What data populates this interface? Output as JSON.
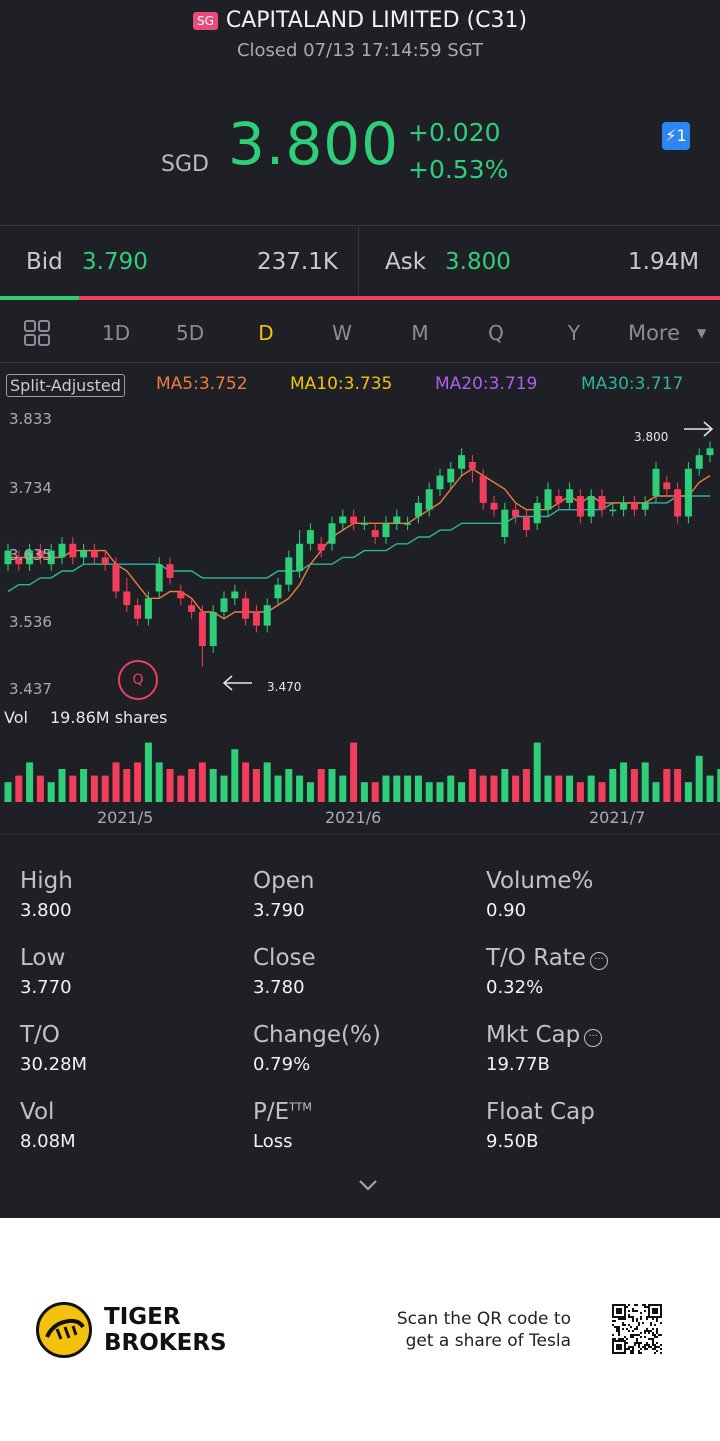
{
  "header": {
    "market_badge": "SG",
    "title": "CAPITALAND LIMITED (C31)",
    "status": "Closed 07/13 17:14:59 SGT",
    "currency": "SGD",
    "price": "3.800",
    "change": "+0.020",
    "change_pct": "+0.53%",
    "flash_icon_text": "⚡1"
  },
  "quote": {
    "bid_label": "Bid",
    "bid_price": "3.790",
    "bid_size": "237.1K",
    "ask_label": "Ask",
    "ask_price": "3.800",
    "ask_size": "1.94M",
    "bid_ratio": 0.11
  },
  "tabs": [
    {
      "label": "1D"
    },
    {
      "label": "5D"
    },
    {
      "label": "D",
      "active": true
    },
    {
      "label": "W"
    },
    {
      "label": "M"
    },
    {
      "label": "Q"
    },
    {
      "label": "Y"
    },
    {
      "label": "More"
    }
  ],
  "chart": {
    "split_adjusted": "Split-Adjusted",
    "ma5": "MA5:3.752",
    "ma10": "MA10:3.735",
    "ma20": "MA20:3.719",
    "ma30": "MA30:3.717",
    "y_ticks": [
      "3.833",
      "3.734",
      "3.635",
      "3.536",
      "3.437"
    ],
    "high_label": "3.800",
    "low_label": "3.470",
    "marker": "Q",
    "vol_label": "Vol",
    "vol_value": "19.86M shares",
    "x_ticks": [
      "2021/5",
      "2021/6",
      "2021/7"
    ],
    "colors": {
      "up": "#2fcf7a",
      "down": "#f23e5c",
      "ma5": "#f07a3a",
      "ma10": "#f4c20d",
      "ma20": "#b05ef0",
      "ma30": "#2fb3a0"
    }
  },
  "chart_data": {
    "type": "candlestick",
    "title": "",
    "ylim": [
      3.437,
      3.833
    ],
    "candles": [
      {
        "o": 3.62,
        "c": 3.64,
        "h": 3.65,
        "l": 3.61
      },
      {
        "o": 3.63,
        "c": 3.62,
        "h": 3.64,
        "l": 3.61
      },
      {
        "o": 3.62,
        "c": 3.64,
        "h": 3.65,
        "l": 3.61
      },
      {
        "o": 3.64,
        "c": 3.63,
        "h": 3.65,
        "l": 3.62
      },
      {
        "o": 3.62,
        "c": 3.64,
        "h": 3.65,
        "l": 3.61
      },
      {
        "o": 3.63,
        "c": 3.65,
        "h": 3.66,
        "l": 3.62
      },
      {
        "o": 3.65,
        "c": 3.63,
        "h": 3.66,
        "l": 3.62
      },
      {
        "o": 3.63,
        "c": 3.64,
        "h": 3.65,
        "l": 3.62
      },
      {
        "o": 3.64,
        "c": 3.63,
        "h": 3.65,
        "l": 3.62
      },
      {
        "o": 3.63,
        "c": 3.62,
        "h": 3.64,
        "l": 3.61
      },
      {
        "o": 3.62,
        "c": 3.58,
        "h": 3.63,
        "l": 3.57
      },
      {
        "o": 3.58,
        "c": 3.56,
        "h": 3.6,
        "l": 3.55
      },
      {
        "o": 3.56,
        "c": 3.54,
        "h": 3.57,
        "l": 3.53
      },
      {
        "o": 3.54,
        "c": 3.57,
        "h": 3.58,
        "l": 3.53
      },
      {
        "o": 3.58,
        "c": 3.62,
        "h": 3.63,
        "l": 3.57
      },
      {
        "o": 3.62,
        "c": 3.6,
        "h": 3.63,
        "l": 3.59
      },
      {
        "o": 3.58,
        "c": 3.57,
        "h": 3.59,
        "l": 3.56
      },
      {
        "o": 3.56,
        "c": 3.55,
        "h": 3.57,
        "l": 3.54
      },
      {
        "o": 3.55,
        "c": 3.5,
        "h": 3.56,
        "l": 3.47
      },
      {
        "o": 3.5,
        "c": 3.55,
        "h": 3.56,
        "l": 3.49
      },
      {
        "o": 3.55,
        "c": 3.57,
        "h": 3.58,
        "l": 3.54
      },
      {
        "o": 3.57,
        "c": 3.58,
        "h": 3.59,
        "l": 3.56
      },
      {
        "o": 3.57,
        "c": 3.54,
        "h": 3.58,
        "l": 3.53
      },
      {
        "o": 3.55,
        "c": 3.53,
        "h": 3.56,
        "l": 3.52
      },
      {
        "o": 3.53,
        "c": 3.56,
        "h": 3.57,
        "l": 3.52
      },
      {
        "o": 3.57,
        "c": 3.59,
        "h": 3.6,
        "l": 3.56
      },
      {
        "o": 3.59,
        "c": 3.63,
        "h": 3.64,
        "l": 3.58
      },
      {
        "o": 3.61,
        "c": 3.65,
        "h": 3.67,
        "l": 3.6
      },
      {
        "o": 3.65,
        "c": 3.67,
        "h": 3.68,
        "l": 3.64
      },
      {
        "o": 3.65,
        "c": 3.64,
        "h": 3.66,
        "l": 3.63
      },
      {
        "o": 3.65,
        "c": 3.68,
        "h": 3.69,
        "l": 3.64
      },
      {
        "o": 3.68,
        "c": 3.69,
        "h": 3.7,
        "l": 3.67
      },
      {
        "o": 3.69,
        "c": 3.68,
        "h": 3.7,
        "l": 3.67
      },
      {
        "o": 3.68,
        "c": 3.68,
        "h": 3.69,
        "l": 3.67
      },
      {
        "o": 3.67,
        "c": 3.66,
        "h": 3.68,
        "l": 3.65
      },
      {
        "o": 3.66,
        "c": 3.68,
        "h": 3.69,
        "l": 3.65
      },
      {
        "o": 3.68,
        "c": 3.69,
        "h": 3.7,
        "l": 3.67
      },
      {
        "o": 3.68,
        "c": 3.68,
        "h": 3.69,
        "l": 3.67
      },
      {
        "o": 3.69,
        "c": 3.71,
        "h": 3.72,
        "l": 3.68
      },
      {
        "o": 3.7,
        "c": 3.73,
        "h": 3.74,
        "l": 3.69
      },
      {
        "o": 3.73,
        "c": 3.75,
        "h": 3.76,
        "l": 3.72
      },
      {
        "o": 3.74,
        "c": 3.76,
        "h": 3.77,
        "l": 3.73
      },
      {
        "o": 3.76,
        "c": 3.78,
        "h": 3.79,
        "l": 3.75
      },
      {
        "o": 3.77,
        "c": 3.76,
        "h": 3.78,
        "l": 3.74
      },
      {
        "o": 3.75,
        "c": 3.71,
        "h": 3.76,
        "l": 3.7
      },
      {
        "o": 3.71,
        "c": 3.7,
        "h": 3.72,
        "l": 3.69
      },
      {
        "o": 3.66,
        "c": 3.7,
        "h": 3.71,
        "l": 3.65
      },
      {
        "o": 3.7,
        "c": 3.69,
        "h": 3.71,
        "l": 3.68
      },
      {
        "o": 3.69,
        "c": 3.67,
        "h": 3.7,
        "l": 3.66
      },
      {
        "o": 3.68,
        "c": 3.71,
        "h": 3.72,
        "l": 3.67
      },
      {
        "o": 3.7,
        "c": 3.73,
        "h": 3.74,
        "l": 3.69
      },
      {
        "o": 3.72,
        "c": 3.71,
        "h": 3.73,
        "l": 3.7
      },
      {
        "o": 3.71,
        "c": 3.73,
        "h": 3.74,
        "l": 3.7
      },
      {
        "o": 3.72,
        "c": 3.69,
        "h": 3.73,
        "l": 3.68
      },
      {
        "o": 3.69,
        "c": 3.72,
        "h": 3.73,
        "l": 3.68
      },
      {
        "o": 3.72,
        "c": 3.7,
        "h": 3.73,
        "l": 3.69
      },
      {
        "o": 3.7,
        "c": 3.7,
        "h": 3.71,
        "l": 3.69
      },
      {
        "o": 3.7,
        "c": 3.71,
        "h": 3.72,
        "l": 3.69
      },
      {
        "o": 3.71,
        "c": 3.7,
        "h": 3.72,
        "l": 3.69
      },
      {
        "o": 3.7,
        "c": 3.71,
        "h": 3.72,
        "l": 3.69
      },
      {
        "o": 3.72,
        "c": 3.76,
        "h": 3.77,
        "l": 3.71
      },
      {
        "o": 3.74,
        "c": 3.73,
        "h": 3.75,
        "l": 3.72
      },
      {
        "o": 3.73,
        "c": 3.69,
        "h": 3.74,
        "l": 3.68
      },
      {
        "o": 3.69,
        "c": 3.76,
        "h": 3.77,
        "l": 3.68
      },
      {
        "o": 3.76,
        "c": 3.78,
        "h": 3.79,
        "l": 3.75
      },
      {
        "o": 3.78,
        "c": 3.79,
        "h": 3.8,
        "l": 3.77
      }
    ],
    "volume_shares_rel": [
      0.3,
      0.4,
      0.6,
      0.4,
      0.3,
      0.5,
      0.4,
      0.5,
      0.4,
      0.4,
      0.6,
      0.5,
      0.6,
      0.9,
      0.6,
      0.5,
      0.4,
      0.5,
      0.6,
      0.5,
      0.4,
      0.8,
      0.6,
      0.5,
      0.6,
      0.4,
      0.5,
      0.4,
      0.3,
      0.5,
      0.5,
      0.4,
      0.9,
      0.3,
      0.3,
      0.4,
      0.4,
      0.4,
      0.4,
      0.3,
      0.3,
      0.4,
      0.3,
      0.5,
      0.4,
      0.4,
      0.5,
      0.4,
      0.5,
      0.9,
      0.4,
      0.4,
      0.4,
      0.3,
      0.4,
      0.3,
      0.5,
      0.6,
      0.5,
      0.6,
      0.3,
      0.5,
      0.5,
      0.3,
      0.7,
      0.4,
      0.5
    ],
    "ma5": [
      3.63,
      3.63,
      3.63,
      3.63,
      3.63,
      3.63,
      3.64,
      3.64,
      3.64,
      3.64,
      3.62,
      3.61,
      3.59,
      3.57,
      3.57,
      3.58,
      3.58,
      3.57,
      3.55,
      3.55,
      3.54,
      3.55,
      3.55,
      3.55,
      3.55,
      3.56,
      3.57,
      3.59,
      3.62,
      3.64,
      3.66,
      3.67,
      3.68,
      3.68,
      3.68,
      3.68,
      3.68,
      3.68,
      3.69,
      3.7,
      3.71,
      3.73,
      3.75,
      3.76,
      3.75,
      3.74,
      3.73,
      3.71,
      3.7,
      3.7,
      3.7,
      3.71,
      3.72,
      3.71,
      3.72,
      3.71,
      3.71,
      3.71,
      3.71,
      3.71,
      3.72,
      3.72,
      3.72,
      3.72,
      3.74,
      3.75
    ],
    "ma30": [
      3.58,
      3.59,
      3.59,
      3.6,
      3.6,
      3.61,
      3.61,
      3.62,
      3.62,
      3.62,
      3.62,
      3.62,
      3.62,
      3.62,
      3.62,
      3.61,
      3.61,
      3.61,
      3.6,
      3.6,
      3.6,
      3.6,
      3.6,
      3.6,
      3.6,
      3.61,
      3.61,
      3.61,
      3.62,
      3.62,
      3.62,
      3.63,
      3.63,
      3.64,
      3.64,
      3.64,
      3.65,
      3.65,
      3.66,
      3.66,
      3.67,
      3.67,
      3.68,
      3.68,
      3.68,
      3.68,
      3.68,
      3.69,
      3.69,
      3.69,
      3.69,
      3.7,
      3.7,
      3.7,
      3.7,
      3.7,
      3.71,
      3.71,
      3.71,
      3.71,
      3.71,
      3.71,
      3.72,
      3.72,
      3.72,
      3.72
    ]
  },
  "stats": [
    {
      "label": "High",
      "value": "3.800"
    },
    {
      "label": "Open",
      "value": "3.790"
    },
    {
      "label": "Volume%",
      "value": "0.90"
    },
    {
      "label": "Low",
      "value": "3.770"
    },
    {
      "label": "Close",
      "value": "3.780"
    },
    {
      "label": "T/O Rate",
      "value": "0.32%"
    },
    {
      "label": "T/O",
      "value": "30.28M"
    },
    {
      "label": "Change(%)",
      "value": "0.79%"
    },
    {
      "label": "Mkt Cap",
      "value": "19.77B"
    },
    {
      "label": "Vol",
      "value": "8.08M"
    },
    {
      "label": "P/E",
      "label_sup": "TTM",
      "value": "Loss"
    },
    {
      "label": "Float Cap",
      "value": "9.50B"
    }
  ],
  "footer": {
    "brand_line1": "TIGER",
    "brand_line2": "BROKERS",
    "scan_line1": "Scan the QR code to",
    "scan_line2": "get a share of Tesla"
  }
}
